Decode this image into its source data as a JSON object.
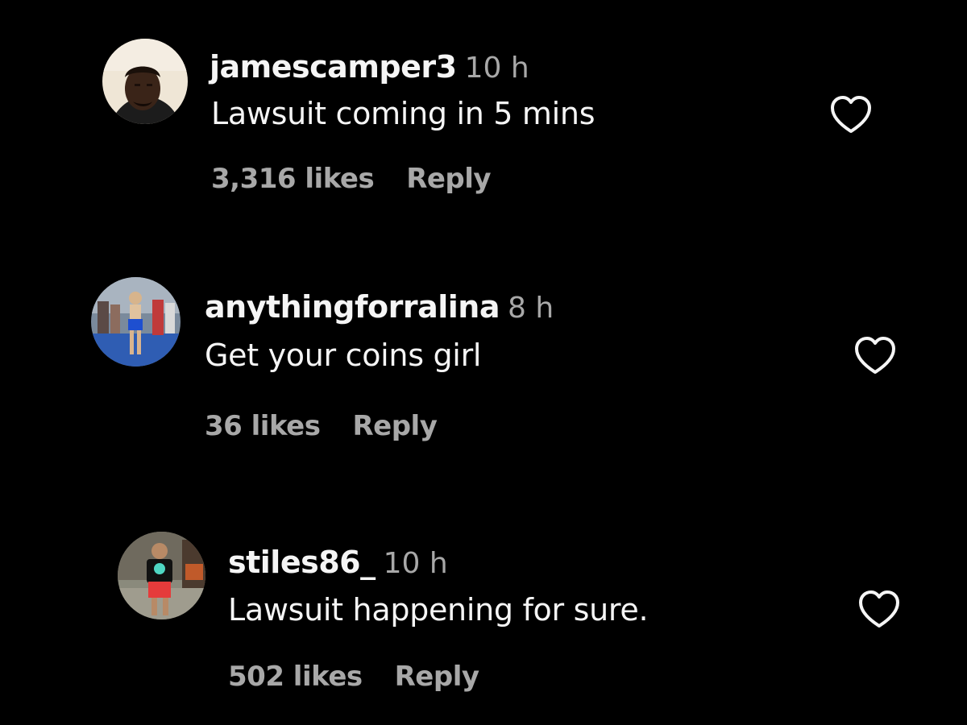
{
  "colors": {
    "background": "#000000",
    "primary_text": "#f5f5f5",
    "secondary_text": "#a8a8a8"
  },
  "comments": [
    {
      "username": "jamescamper3",
      "time": "10 h",
      "text": "Lawsuit coming in 5 mins",
      "likes": "3,316 likes",
      "reply_label": "Reply",
      "like_icon": "heart-outline-icon"
    },
    {
      "username": "anythingforralina",
      "time": "8 h",
      "text": "Get your coins girl",
      "likes": "36 likes",
      "reply_label": "Reply",
      "like_icon": "heart-outline-icon"
    },
    {
      "username": "stiles86_",
      "time": "10 h",
      "text": "Lawsuit happening for sure.",
      "likes": "502 likes",
      "reply_label": "Reply",
      "like_icon": "heart-outline-icon"
    }
  ]
}
